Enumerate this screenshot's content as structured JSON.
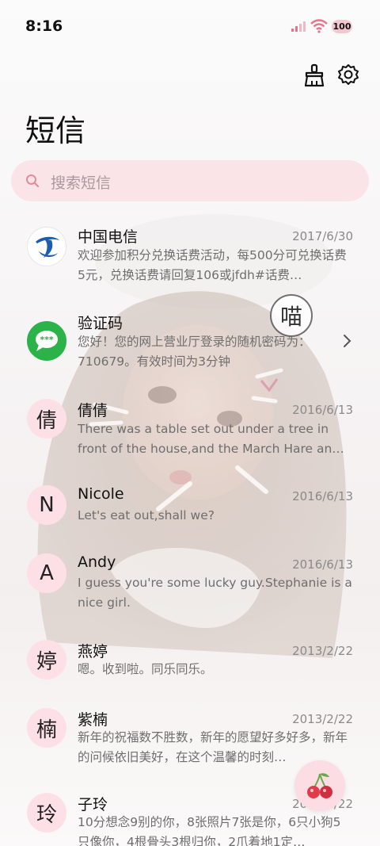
{
  "status": {
    "time": "8:16",
    "battery": "100"
  },
  "header": {
    "title": "短信"
  },
  "search": {
    "placeholder": "搜索短信"
  },
  "conversations": [
    {
      "avatar": "",
      "name": "中国电信",
      "date": "2017/6/30",
      "snippet": "欢迎参加积分兑换话费活动，每500分可兑换话费5元，兑换话费请回复106或jfdh#话费…"
    },
    {
      "avatar": "",
      "name": "验证码",
      "date": "",
      "snippet": "您好！您的网上营业厅登录的随机密码为：710679。有效时间为3分钟"
    },
    {
      "avatar": "倩",
      "name": "倩倩",
      "date": "2016/6/13",
      "snippet": "There was a table set out under a tree in front of the house,and the March Hare an…"
    },
    {
      "avatar": "N",
      "name": "Nicole",
      "date": "2016/6/13",
      "snippet": "Let's eat out,shall we?"
    },
    {
      "avatar": "A",
      "name": "Andy",
      "date": "2016/6/13",
      "snippet": "I guess you're some lucky guy.Stephanie is a nice girl."
    },
    {
      "avatar": "婷",
      "name": "燕婷",
      "date": "2013/2/22",
      "snippet": "嗯。收到啦。同乐同乐。"
    },
    {
      "avatar": "楠",
      "name": "紫楠",
      "date": "2013/2/22",
      "snippet": "新年的祝福数不胜数，新年的愿望好多好多，新年的问候依旧美好，在这个温馨的时刻…"
    },
    {
      "avatar": "玲",
      "name": "子玲",
      "date": "2013/2/22",
      "snippet": "10分想念9别的你，8张照片7张是你，6只小狗5只像你，4根骨头3根归你，2爪着地1定…"
    }
  ],
  "decor": {
    "wallpaper_text": "喵"
  },
  "colors": {
    "accent_pink": "#fbe4e8",
    "avatar_bg": "#fde0e5",
    "telecom_blue": "#1a5db0",
    "sms_green": "#2bb34a"
  },
  "icons": [
    "clean-brush-icon",
    "settings-gear-icon",
    "search-icon",
    "chevron-right-icon",
    "cherry-icon"
  ]
}
